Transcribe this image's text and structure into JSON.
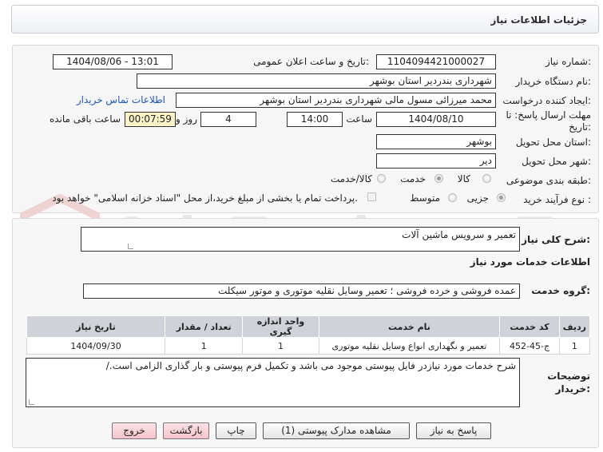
{
  "header": {
    "title": "جزئیات اطلاعات نیاز"
  },
  "watermark": {
    "text": "AriaTender.neT"
  },
  "form": {
    "need_number_label": "شماره نیاز:",
    "need_number": "1104094421000027",
    "announce_label": "تاریخ و ساعت اعلان عمومی:",
    "announce_value": "1404/08/06 - 13:01",
    "buyer_label": "نام دستگاه خریدار:",
    "buyer_value": "شهرداری بندردیر استان بوشهر",
    "creator_label": "ایجاد کننده درخواست:",
    "creator_value": "محمد میرزائی مسول مالی شهرداری بندردیر استان بوشهر",
    "contact_link": "اطلاعات تماس خریدار",
    "deadline_label": "مهلت ارسال پاسخ: تا تاریخ:",
    "deadline_date": "1404/08/10",
    "time_label": "ساعت",
    "deadline_time": "14:00",
    "days_value": "4",
    "days_label": "روز و",
    "remaining_time": "00:07:59",
    "remaining_label": "ساعت باقی مانده",
    "province_label": "استان محل تحویل:",
    "province_value": "بوشهر",
    "city_label": "شهر محل تحویل:",
    "city_value": "دیر",
    "category_label": "طبقه بندی موضوعی:",
    "category_options": [
      "کالا",
      "خدمت",
      "کالا/خدمت"
    ],
    "process_label": "نوع فرآیند خرید :",
    "process_options": [
      "جزیی",
      "متوسط"
    ],
    "payment_note": "پرداخت تمام یا بخشی از مبلغ خرید،از محل \"اسناد خزانه اسلامی\" خواهد بود."
  },
  "details": {
    "summary_label": "شرح کلی نیاز:",
    "summary_value": "تعمیر و سرویس ماشین آلات",
    "services_title": "اطلاعات خدمات مورد نیاز",
    "group_label": "گروه خدمت:",
    "group_value": "عمده فروشی و خرده فروشی ؛ تعمیر وسایل نقلیه موتوری و موتور سیکلت",
    "table": {
      "headers": [
        "ردیف",
        "کد خدمت",
        "نام خدمت",
        "واحد اندازه گیری",
        "تعداد / مقدار",
        "تاریخ نیاز"
      ],
      "rows": [
        [
          "1",
          "ج-45-452",
          "تعمیر و نگهداری انواع وسایل نقلیه موتوری",
          "1",
          "1",
          "1404/09/30"
        ]
      ]
    },
    "buyer_notes_label": "توضیحات خریدار:",
    "buyer_notes_value": "شرح خدمات مورد نیازدر فایل پیوستی موجود می باشد و  تکمیل فرم پیوستی و بار گذاری  الزامی است./"
  },
  "buttons": {
    "reply": "پاسخ به نیاز",
    "view_docs": "مشاهده مدارک پیوستی (1)",
    "print": "چاپ",
    "back": "بازگشت",
    "exit": "خروج"
  },
  "colors": {
    "link": "#1a56c4",
    "remaining_bg": "#fbf3c6",
    "pink_button": "#f6c3cb"
  }
}
